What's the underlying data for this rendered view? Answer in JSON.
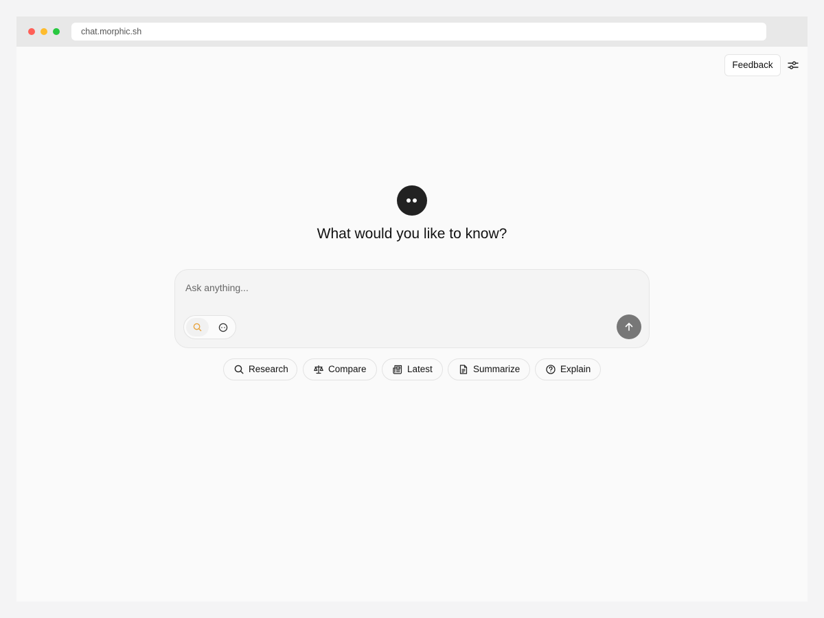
{
  "browser": {
    "url": "chat.morphic.sh"
  },
  "header": {
    "feedback_label": "Feedback",
    "settings_icon": "sliders-icon"
  },
  "hero": {
    "headline": "What would you like to know?",
    "logo_icon": "morphic-logo-icon"
  },
  "composer": {
    "placeholder": "Ask anything...",
    "value": "",
    "modes": [
      {
        "icon": "search-icon",
        "active": true
      },
      {
        "icon": "chat-dots-icon",
        "active": false
      }
    ],
    "send_icon": "arrow-up-icon"
  },
  "suggestions": [
    {
      "label": "Research",
      "icon": "search-icon"
    },
    {
      "label": "Compare",
      "icon": "scale-icon"
    },
    {
      "label": "Latest",
      "icon": "newspaper-icon"
    },
    {
      "label": "Summarize",
      "icon": "file-text-icon"
    },
    {
      "label": "Explain",
      "icon": "help-circle-icon"
    }
  ],
  "colors": {
    "accent_search": "#e8a33d",
    "send_button": "#777777",
    "logo_bg": "#222222"
  }
}
